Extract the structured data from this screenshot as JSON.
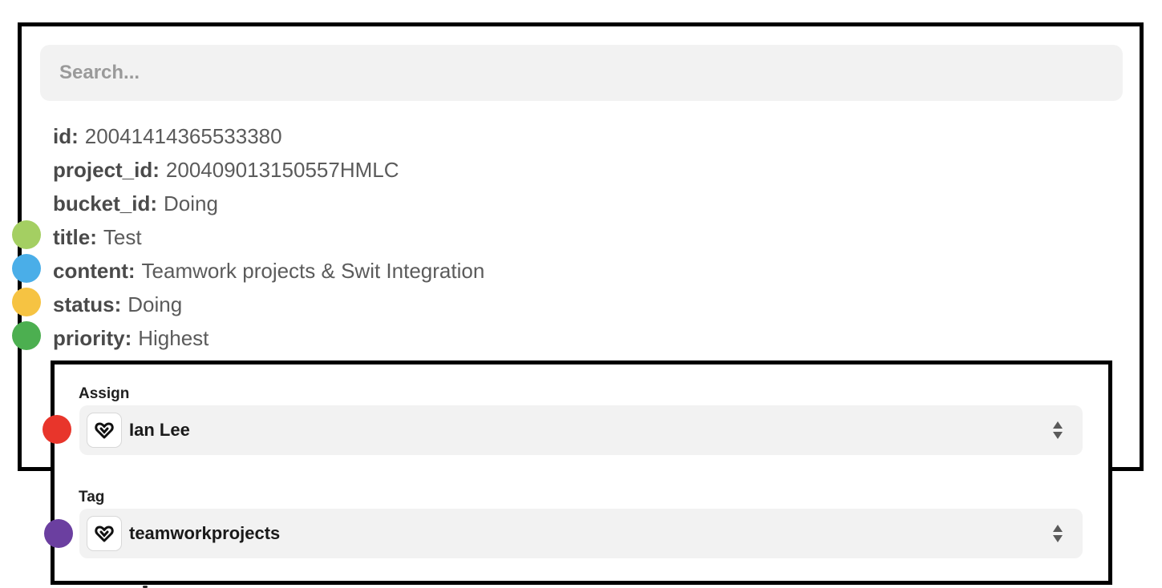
{
  "search": {
    "placeholder": "Search..."
  },
  "fields": [
    {
      "key": "id:",
      "value": "20041414365533380",
      "dot": null
    },
    {
      "key": "project_id:",
      "value": "200409013150557HMLC",
      "dot": null
    },
    {
      "key": "bucket_id:",
      "value": "Doing",
      "dot": null
    },
    {
      "key": "title:",
      "value": "Test",
      "dot": "#a4cf62"
    },
    {
      "key": "content:",
      "value": "Teamwork projects & Swit Integration",
      "dot": "#4aaee8"
    },
    {
      "key": "status:",
      "value": "Doing",
      "dot": "#f6c342"
    },
    {
      "key": "priority:",
      "value": "Highest",
      "dot": "#4caf50"
    }
  ],
  "form": {
    "assign": {
      "label": "Assign",
      "value": "Ian Lee",
      "dot": "#e8352b",
      "icon": "app-logo-icon"
    },
    "tag": {
      "label": "Tag",
      "value": "teamworkprojects",
      "dot": "#6b3fa0",
      "icon": "app-logo-icon"
    }
  }
}
